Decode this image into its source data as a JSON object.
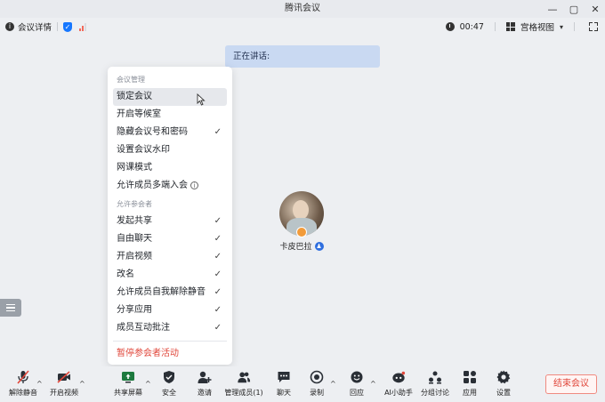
{
  "window": {
    "title": "腾讯会议"
  },
  "topbar": {
    "meeting_details": "会议详情",
    "timer": "00:47",
    "view_mode": "宫格视图"
  },
  "speaking_banner": "正在讲话:",
  "menu": {
    "section_manage": "会议管理",
    "manage_items": [
      {
        "label": "锁定会议",
        "checked": false
      },
      {
        "label": "开启等候室",
        "checked": false
      },
      {
        "label": "隐藏会议号和密码",
        "checked": true
      },
      {
        "label": "设置会议水印",
        "checked": false
      },
      {
        "label": "网课模式",
        "checked": false
      },
      {
        "label": "允许成员多端入会",
        "checked": false
      }
    ],
    "section_allow": "允许参会者",
    "allow_items": [
      {
        "label": "发起共享",
        "checked": true
      },
      {
        "label": "自由聊天",
        "checked": true
      },
      {
        "label": "开启视频",
        "checked": true
      },
      {
        "label": "改名",
        "checked": true
      },
      {
        "label": "允许成员自我解除静音",
        "checked": true
      },
      {
        "label": "分享应用",
        "checked": true
      },
      {
        "label": "成员互动批注",
        "checked": true
      }
    ],
    "pause_activity": "暂停参会者活动",
    "check_mark": "✓"
  },
  "participant": {
    "name": "卡皮巴拉"
  },
  "toolbar": {
    "unmute": "解除静音",
    "start_video": "开启视频",
    "share_screen": "共享屏幕",
    "security": "安全",
    "invite": "邀请",
    "manage_members": "管理成员(1)",
    "chat": "聊天",
    "record": "录制",
    "reactions": "回应",
    "ai_assistant": "AI小助手",
    "breakout": "分组讨论",
    "apps": "应用",
    "settings": "设置",
    "end_meeting": "结束会议"
  },
  "colors": {
    "accent_blue": "#1677ff",
    "danger_red": "#e0463a",
    "banner_bg": "#c9d9f2"
  }
}
